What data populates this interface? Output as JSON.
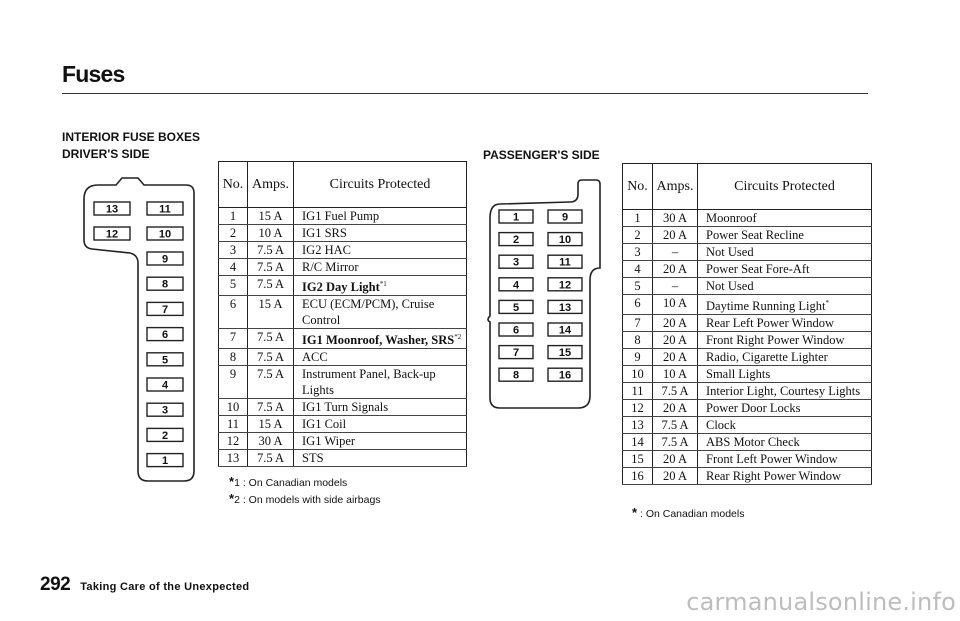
{
  "page": {
    "title": "Fuses",
    "section_heading": "INTERIOR FUSE BOXES",
    "driver_heading": "DRIVER'S SIDE",
    "passenger_heading": "PASSENGER'S SIDE",
    "page_number": "292",
    "chapter": "Taking Care of the Unexpected",
    "watermark": "carmanualsonline.info"
  },
  "driver": {
    "diagram_slots": [
      "13",
      "11",
      "12",
      "10",
      "9",
      "8",
      "7",
      "6",
      "5",
      "4",
      "3",
      "2",
      "1"
    ],
    "headers": {
      "no": "No.",
      "amps": "Amps.",
      "circuits": "Circuits Protected"
    },
    "rows": [
      {
        "no": "1",
        "amps": "15 A",
        "circuit": "IG1 Fuel Pump",
        "lines": 1
      },
      {
        "no": "2",
        "amps": "10 A",
        "circuit": "IG1 SRS",
        "lines": 1
      },
      {
        "no": "3",
        "amps": "7.5 A",
        "circuit": "IG2 HAC",
        "lines": 1
      },
      {
        "no": "4",
        "amps": "7.5 A",
        "circuit": "R/C Mirror",
        "lines": 1
      },
      {
        "no": "5",
        "amps": "7.5 A",
        "circuit": "IG2 Day Light",
        "footnote": "*1",
        "bold": true,
        "lines": 1
      },
      {
        "no": "6",
        "amps": "15 A",
        "circuit": "ECU (ECM/PCM), Cruise Control",
        "lines": 2
      },
      {
        "no": "7",
        "amps": "7.5 A",
        "circuit": "IG1 Moonroof, Washer, SRS",
        "footnote": "*2",
        "bold": true,
        "lines": 1
      },
      {
        "no": "8",
        "amps": "7.5 A",
        "circuit": "ACC",
        "lines": 1
      },
      {
        "no": "9",
        "amps": "7.5 A",
        "circuit": "Instrument Panel, Back-up Lights",
        "lines": 2
      },
      {
        "no": "10",
        "amps": "7.5 A",
        "circuit": "IG1 Turn Signals",
        "lines": 1
      },
      {
        "no": "11",
        "amps": "15 A",
        "circuit": "IG1 Coil",
        "lines": 1
      },
      {
        "no": "12",
        "amps": "30 A",
        "circuit": "IG1 Wiper",
        "lines": 1
      },
      {
        "no": "13",
        "amps": "7.5 A",
        "circuit": "STS",
        "lines": 1
      }
    ],
    "notes": [
      {
        "mark": "*",
        "text": "1 :  On Canadian models"
      },
      {
        "mark": "*",
        "text": "2 : On models with side airbags"
      }
    ]
  },
  "passenger": {
    "diagram_slots_left": [
      "1",
      "2",
      "3",
      "4",
      "5",
      "6",
      "7",
      "8"
    ],
    "diagram_slots_right": [
      "9",
      "10",
      "11",
      "12",
      "13",
      "14",
      "15",
      "16"
    ],
    "headers": {
      "no": "No.",
      "amps": "Amps.",
      "circuits": "Circuits Protected"
    },
    "rows": [
      {
        "no": "1",
        "amps": "30 A",
        "circuit": "Moonroof",
        "lines": 1
      },
      {
        "no": "2",
        "amps": "20 A",
        "circuit": "Power Seat Recline",
        "lines": 1
      },
      {
        "no": "3",
        "amps": "–",
        "circuit": "Not Used",
        "lines": 1
      },
      {
        "no": "4",
        "amps": "20 A",
        "circuit": "Power Seat Fore-Aft",
        "lines": 1
      },
      {
        "no": "5",
        "amps": "–",
        "circuit": "Not Used",
        "lines": 1
      },
      {
        "no": "6",
        "amps": "10 A",
        "circuit": "Daytime Running Light",
        "footnote": "*",
        "lines": 1
      },
      {
        "no": "7",
        "amps": "20 A",
        "circuit": "Rear Left Power Window",
        "lines": 1
      },
      {
        "no": "8",
        "amps": "20 A",
        "circuit": "Front Right Power Window",
        "lines": 1
      },
      {
        "no": "9",
        "amps": "20 A",
        "circuit": "Radio, Cigarette Lighter",
        "lines": 1
      },
      {
        "no": "10",
        "amps": "10 A",
        "circuit": "Small Lights",
        "lines": 1
      },
      {
        "no": "11",
        "amps": "7.5 A",
        "circuit": "Interior Light, Courtesy Lights",
        "lines": 2
      },
      {
        "no": "12",
        "amps": "20 A",
        "circuit": "Power Door Locks",
        "lines": 1
      },
      {
        "no": "13",
        "amps": "7.5 A",
        "circuit": "Clock",
        "lines": 1
      },
      {
        "no": "14",
        "amps": "7.5 A",
        "circuit": "ABS Motor Check",
        "lines": 1
      },
      {
        "no": "15",
        "amps": "20 A",
        "circuit": "Front Left Power Window",
        "lines": 1
      },
      {
        "no": "16",
        "amps": "20 A",
        "circuit": "Rear Right Power Window",
        "lines": 1
      }
    ],
    "notes": [
      {
        "mark": "*",
        "text": " : On Canadian models"
      }
    ]
  }
}
